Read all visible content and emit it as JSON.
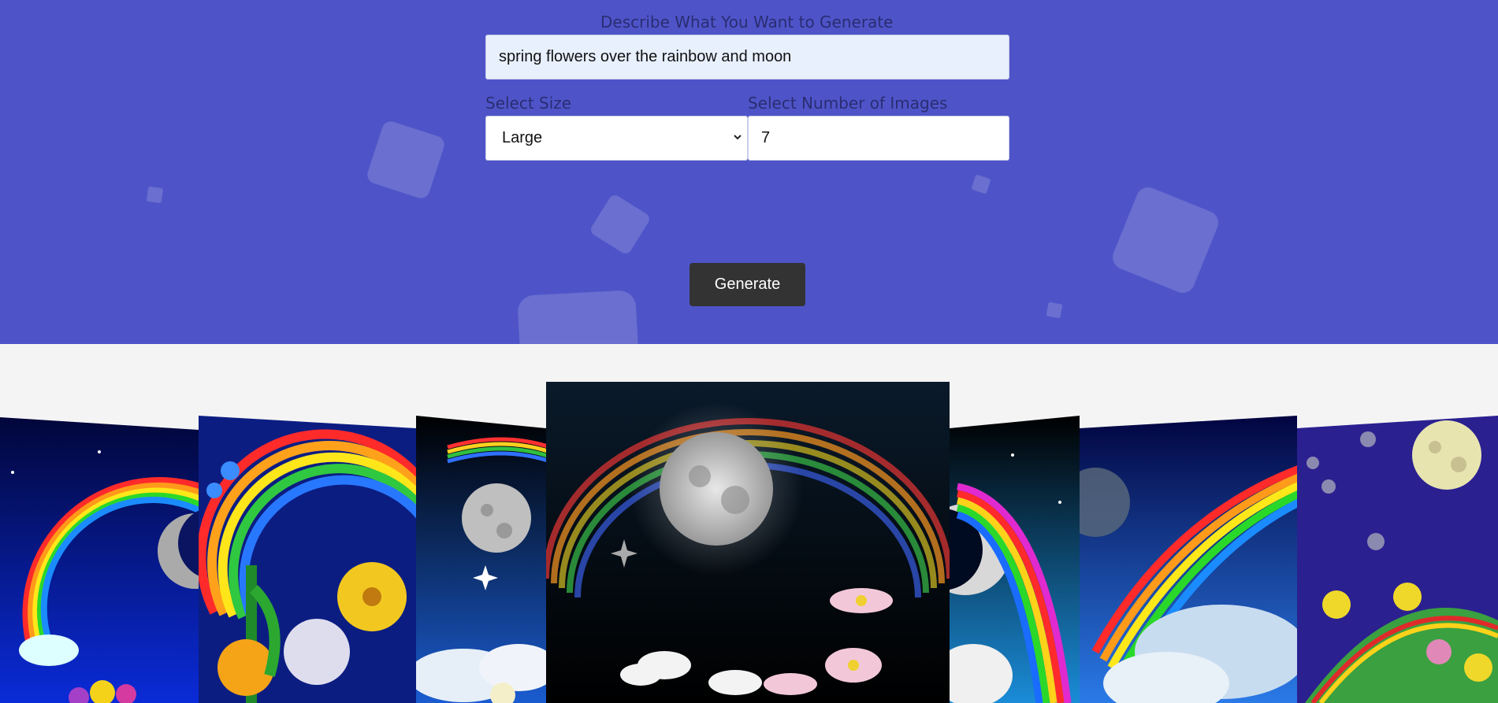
{
  "form": {
    "prompt_label": "Describe What You Want to Generate",
    "prompt_value": "spring flowers over the rainbow and moon",
    "size_label": "Select Size",
    "size_value": "Large",
    "count_label": "Select Number of Images",
    "count_value": "7",
    "generate_label": "Generate"
  },
  "colors": {
    "hero_background": "#4e54c8",
    "page_background": "#f4f4f4",
    "button_background": "#333333"
  },
  "gallery": {
    "image_count": 7,
    "images": [
      {
        "subject": "rainbow, crescent moon and flowers"
      },
      {
        "subject": "rainbow with spring flowers"
      },
      {
        "subject": "rainbow and moon over clouds"
      },
      {
        "subject": "full moon, rainbow and daisies"
      },
      {
        "subject": "crescent moon and rainbow"
      },
      {
        "subject": "rainbow, moon and clouds"
      },
      {
        "subject": "moon over flower hill"
      }
    ]
  }
}
